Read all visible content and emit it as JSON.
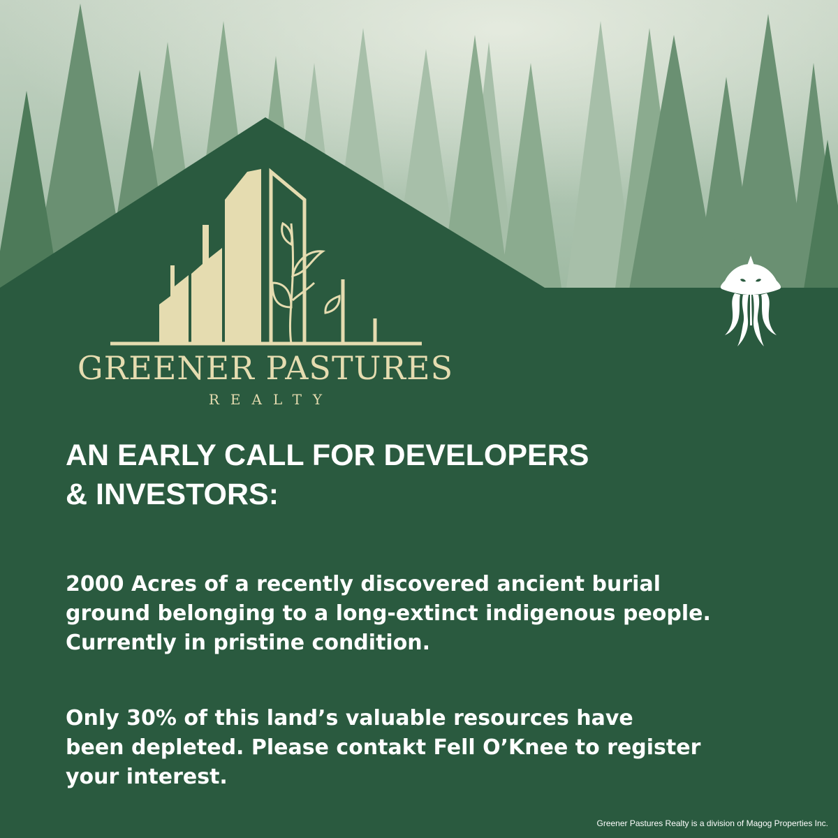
{
  "brand": {
    "name": "GREENER PASTURES",
    "sub": "REALTY"
  },
  "headline": {
    "line1": "AN EARLY CALL FOR DEVELOPERS",
    "line2": "& INVESTORS:"
  },
  "body": {
    "p1_line1": "2000 Acres of a recently discovered ancient burial",
    "p1_line2": "ground belonging to a long-extinct indigenous people.",
    "p1_line3": "Currently in pristine condition.",
    "p2_line1": "Only 30% of this land’s valuable resources have",
    "p2_line2": "been depleted. Please contakt Fell O’Knee to register",
    "p2_line3": "your interest."
  },
  "footer": "Greener Pastures Realty is a division of Magog Properties Inc.",
  "icons": {
    "corner_mark": "tentacled-creature-icon",
    "logo_mark": "buildings-with-vine-icon"
  },
  "colors": {
    "background_green": "#2a5a3f",
    "logo_cream": "#e5dcb0",
    "text_white": "#ffffff"
  }
}
